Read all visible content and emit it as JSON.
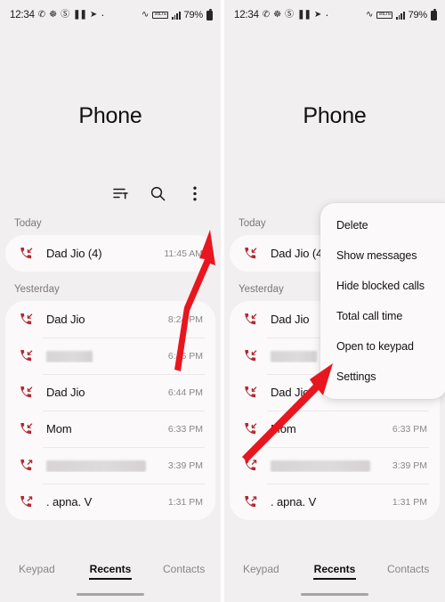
{
  "status_bar": {
    "clock": "12:34",
    "left_icons": [
      "whatsapp-icon",
      "lifebuoy-icon",
      "record-icon",
      "pause-icon",
      "telegram-icon",
      "dot-icon"
    ],
    "wifi_icon": "wifi-icon",
    "volte_label": "VoLTE",
    "signal_icon": "signal-bars-icon",
    "battery_percent": "79%",
    "battery_icon": "battery-icon"
  },
  "app": {
    "title": "Phone"
  },
  "toolbar": {
    "sort_icon": "sort-filter-icon",
    "search_icon": "search-icon",
    "more_icon": "three-dot-menu-icon"
  },
  "sections": [
    {
      "header": "Today",
      "rows": [
        {
          "name": "Dad Jio (4)",
          "time": "11:45 AM",
          "direction": "incoming",
          "redacted": false
        }
      ]
    },
    {
      "header": "Yesterday",
      "rows": [
        {
          "name": "Dad Jio",
          "time": "8:24 PM",
          "direction": "incoming",
          "redacted": false
        },
        {
          "name": "",
          "time": "6:46 PM",
          "direction": "incoming",
          "redacted": true,
          "redact_width": "w1"
        },
        {
          "name": "Dad Jio",
          "time": "6:44 PM",
          "direction": "incoming",
          "redacted": false
        },
        {
          "name": "Mom",
          "time": "6:33 PM",
          "direction": "incoming",
          "redacted": false
        },
        {
          "name": "",
          "time": "3:39 PM",
          "direction": "outgoing",
          "redacted": true,
          "redact_width": "w2"
        },
        {
          "name": ". apna. V",
          "time": "1:31 PM",
          "direction": "outgoing",
          "redacted": false
        }
      ]
    }
  ],
  "menu": {
    "items": [
      "Delete",
      "Show messages",
      "Hide blocked calls",
      "Total call time",
      "Open to keypad",
      "Settings"
    ]
  },
  "tabs": [
    {
      "label": "Keypad",
      "active": false
    },
    {
      "label": "Recents",
      "active": true
    },
    {
      "label": "Contacts",
      "active": false
    }
  ],
  "annotations": {
    "arrow_color": "#e8161f",
    "left_arrow_target": "three-dot-menu-icon",
    "right_arrow_target": "menu-item-settings"
  }
}
